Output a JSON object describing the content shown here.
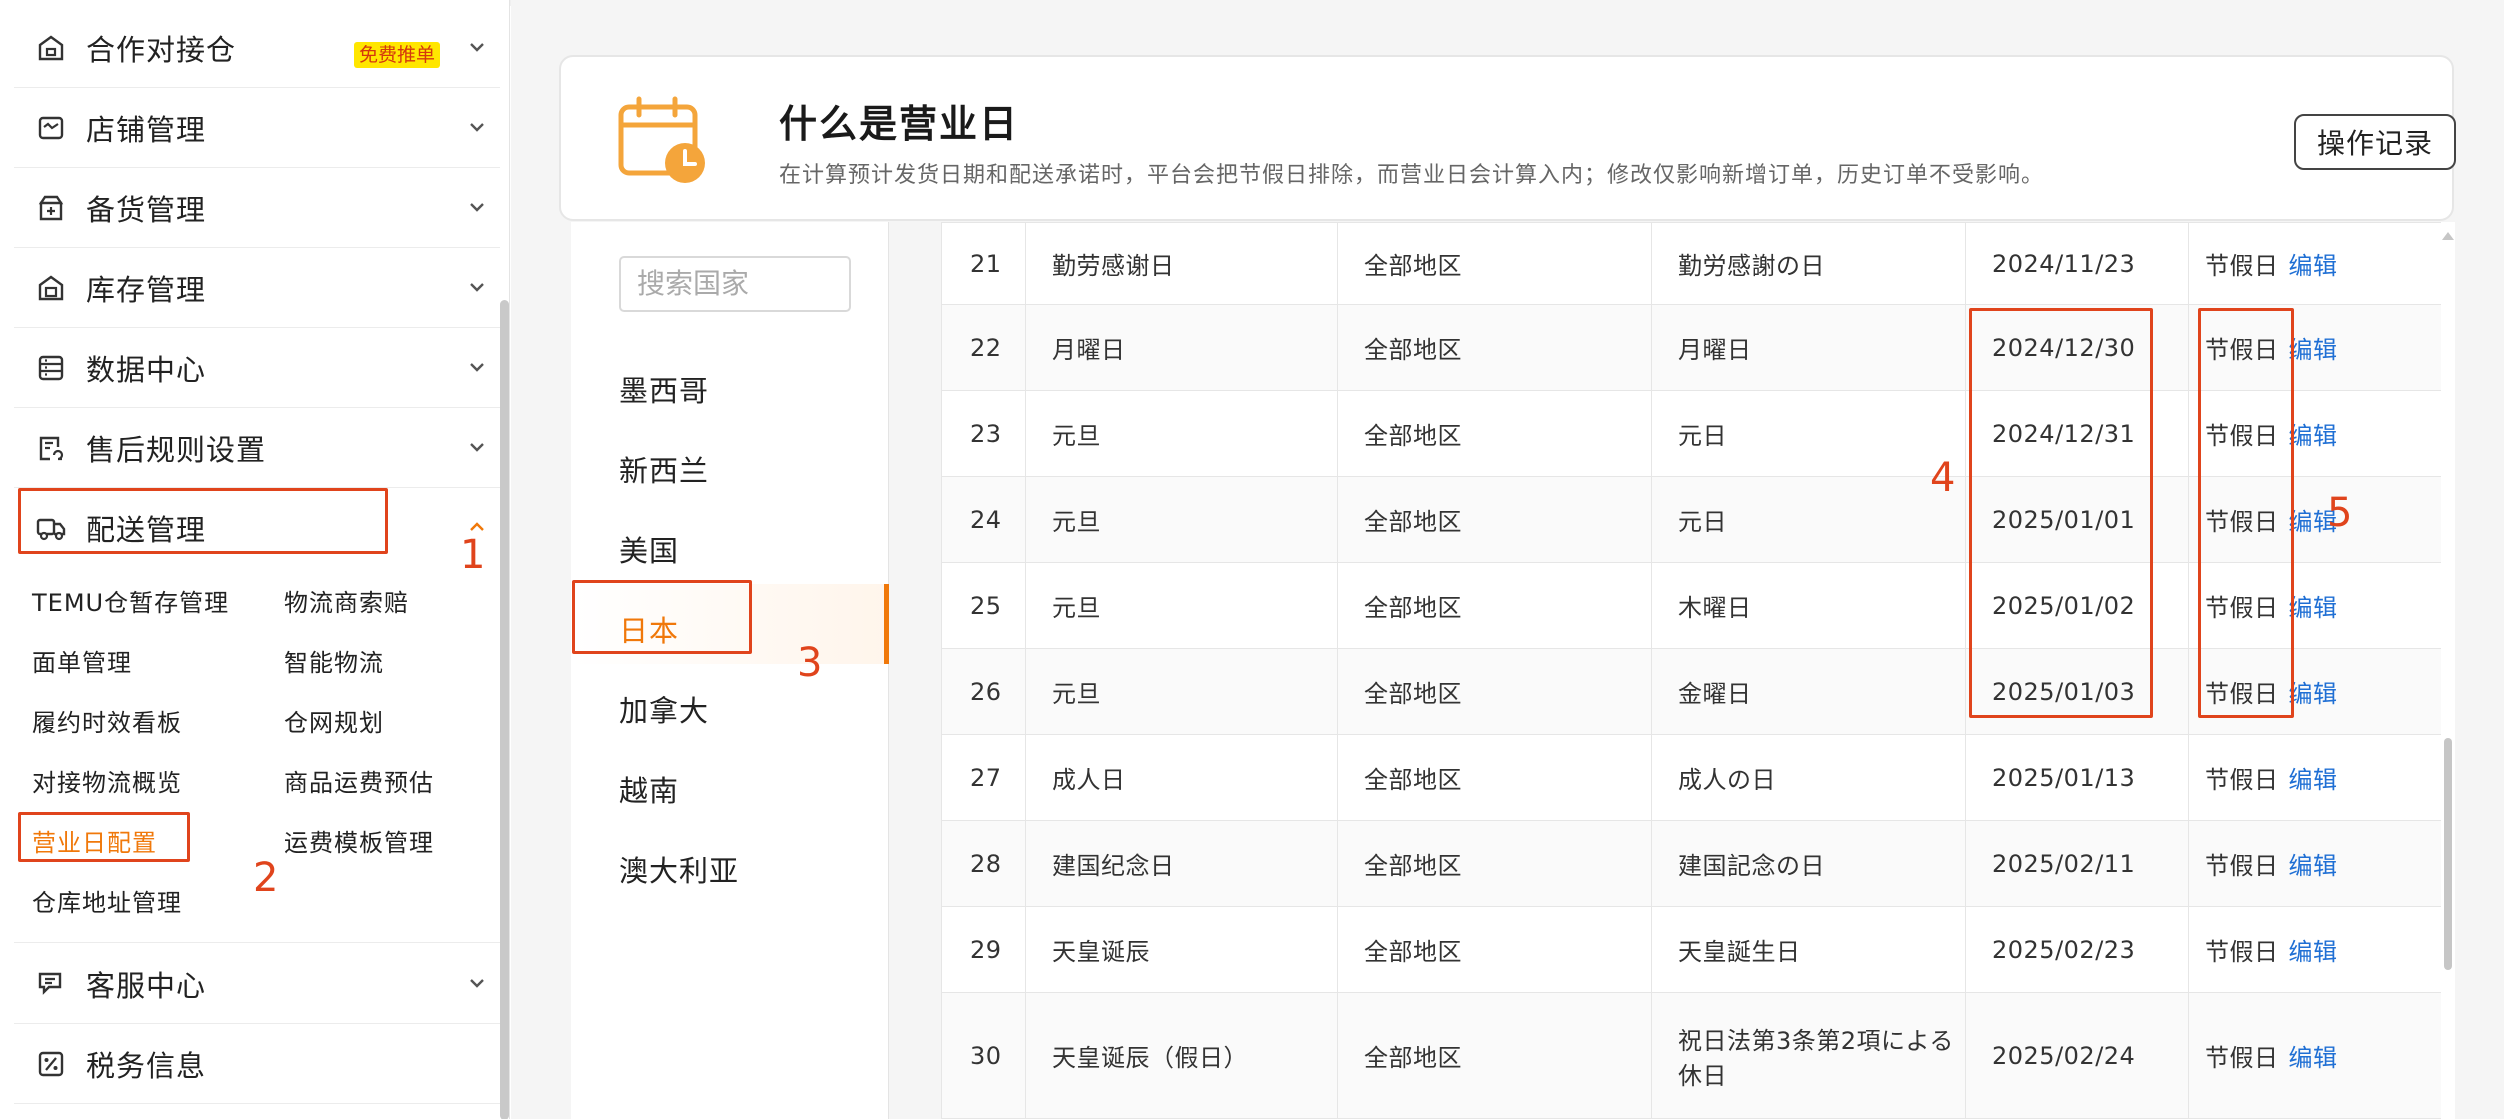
{
  "sidebar": {
    "menus": [
      {
        "label": "合作对接仓",
        "icon": "warehouse-icon",
        "badge": "免费推单",
        "chevron": "down"
      },
      {
        "label": "店铺管理",
        "icon": "store-icon",
        "chevron": "down"
      },
      {
        "label": "备货管理",
        "icon": "stock-icon",
        "chevron": "down"
      },
      {
        "label": "库存管理",
        "icon": "inventory-icon",
        "chevron": "down"
      },
      {
        "label": "数据中心",
        "icon": "data-icon",
        "chevron": "down"
      },
      {
        "label": "售后规则设置",
        "icon": "aftersale-icon",
        "chevron": "down"
      },
      {
        "label": "配送管理",
        "icon": "truck-icon",
        "chevron": "up"
      },
      {
        "label": "客服中心",
        "icon": "chat-icon",
        "chevron": "down"
      },
      {
        "label": "税务信息",
        "icon": "percent-icon"
      }
    ],
    "submenu": [
      "TEMU仓暂存管理",
      "物流商索赔",
      "面单管理",
      "智能物流",
      "履约时效看板",
      "仓网规划",
      "对接物流概览",
      "商品运费预估",
      "营业日配置",
      "运费模板管理",
      "仓库地址管理"
    ]
  },
  "header": {
    "title": "什么是营业日",
    "description": "在计算预计发货日期和配送承诺时，平台会把节假日排除，而营业日会计算入内；修改仅影响新增订单，历史订单不受影响。",
    "op_button": "操作记录"
  },
  "countries": {
    "search_placeholder": "搜索国家",
    "list": [
      "墨西哥",
      "新西兰",
      "美国",
      "日本",
      "加拿大",
      "越南",
      "澳大利亚"
    ],
    "selected": "日本"
  },
  "table": {
    "edit_label": "编辑",
    "rows": [
      {
        "no": "21",
        "name": "勤劳感谢日",
        "region": "全部地区",
        "local_name": "勤労感謝の日",
        "date": "2024/11/23",
        "type": "节假日"
      },
      {
        "no": "22",
        "name": "月曜日",
        "region": "全部地区",
        "local_name": "月曜日",
        "date": "2024/12/30",
        "type": "节假日"
      },
      {
        "no": "23",
        "name": "元旦",
        "region": "全部地区",
        "local_name": "元日",
        "date": "2024/12/31",
        "type": "节假日"
      },
      {
        "no": "24",
        "name": "元旦",
        "region": "全部地区",
        "local_name": "元日",
        "date": "2025/01/01",
        "type": "节假日"
      },
      {
        "no": "25",
        "name": "元旦",
        "region": "全部地区",
        "local_name": "木曜日",
        "date": "2025/01/02",
        "type": "节假日"
      },
      {
        "no": "26",
        "name": "元旦",
        "region": "全部地区",
        "local_name": "金曜日",
        "date": "2025/01/03",
        "type": "节假日"
      },
      {
        "no": "27",
        "name": "成人日",
        "region": "全部地区",
        "local_name": "成人の日",
        "date": "2025/01/13",
        "type": "节假日"
      },
      {
        "no": "28",
        "name": "建国纪念日",
        "region": "全部地区",
        "local_name": "建国記念の日",
        "date": "2025/02/11",
        "type": "节假日"
      },
      {
        "no": "29",
        "name": "天皇诞辰",
        "region": "全部地区",
        "local_name": "天皇誕生日",
        "date": "2025/02/23",
        "type": "节假日"
      },
      {
        "no": "30",
        "name": "天皇诞辰（假日）",
        "region": "全部地区",
        "local_name": "祝日法第3条第2項による休日",
        "date": "2025/02/24",
        "type": "节假日"
      }
    ]
  },
  "annotations": [
    "1",
    "2",
    "3",
    "4",
    "5"
  ],
  "colors": {
    "accent": "#f0780a",
    "annotation": "#e0441c",
    "link": "#1f6fd4",
    "badge_bg": "#ffe600"
  }
}
